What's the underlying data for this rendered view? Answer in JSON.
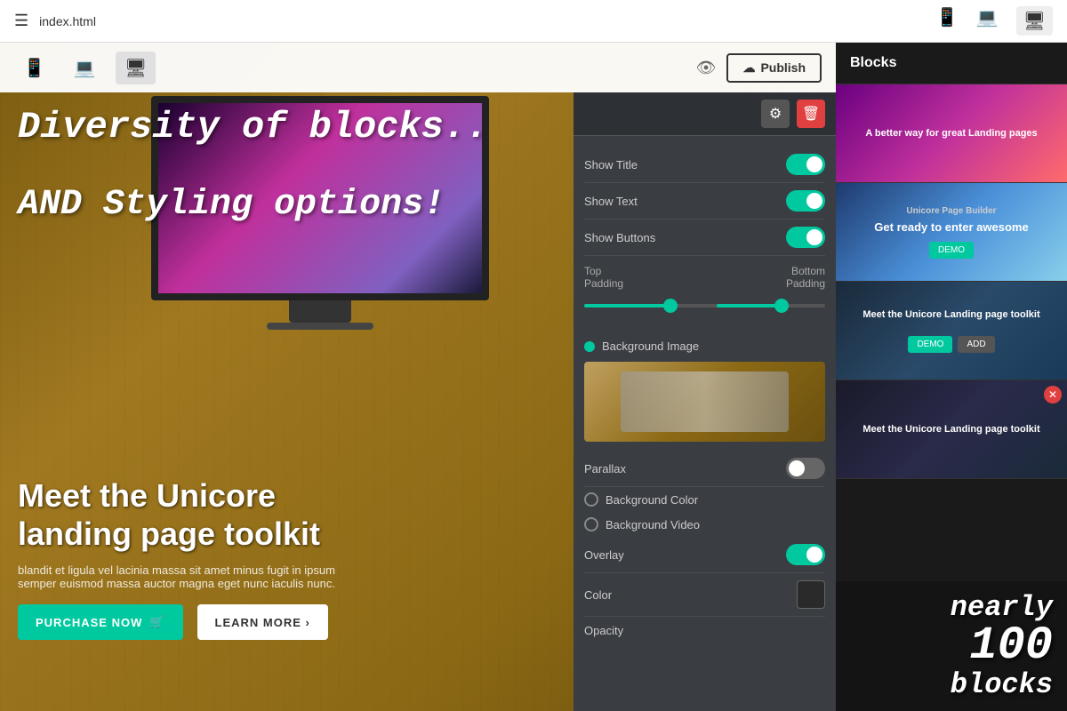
{
  "topbar": {
    "menu_label": "☰",
    "file_name": "index.html",
    "devices": [
      "📱",
      "💻",
      "🖥"
    ],
    "active_device_index": 2
  },
  "toolbar": {
    "devices": [
      "📱",
      "💻",
      "🖥"
    ],
    "active_device_index": 2,
    "eye_label": "👁",
    "publish_label": "Publish",
    "upload_icon": "☁"
  },
  "promo": {
    "line1": "Diversity of blocks..",
    "line2": "AND Styling options!"
  },
  "hero": {
    "title_line1": "Meet the Unicore",
    "title_line2": "landing page toolkit",
    "subtitle": "blandit et ligula vel lacinia massa sit amet minus fugit in ipsum semper euismod massa auctor magna eget nunc iaculis nunc.",
    "btn_purchase": "PURCHASE NOW",
    "btn_learn": "LEARN MORE"
  },
  "settings_panel": {
    "gear_icon": "⚙",
    "trash_icon": "🗑",
    "show_title_label": "Show Title",
    "show_title_on": true,
    "show_text_label": "Show Text",
    "show_text_on": true,
    "show_buttons_label": "Show Buttons",
    "show_buttons_on": true,
    "top_padding_label": "Top\nPadding",
    "bottom_padding_label": "Bottom\nPadding",
    "bg_image_label": "Background Image",
    "parallax_label": "Parallax",
    "parallax_on": false,
    "bg_color_label": "Background Color",
    "bg_video_label": "Background Video",
    "overlay_label": "Overlay",
    "overlay_on": true,
    "color_label": "Color",
    "opacity_label": "Opacity"
  },
  "blocks_panel": {
    "title": "Blocks",
    "block1_text": "A better way for great Landing pages",
    "block2_text": "Get ready to enter awesome",
    "block2_subtitle": "Unicore Page Builder",
    "block3_text": "Meet the Unicore\nLanding page toolkit",
    "block4_text": "Meet the Unicore\nLanding page toolkit",
    "promo_line1": "nearly",
    "promo_line2": "100",
    "promo_line3": "blocks"
  }
}
